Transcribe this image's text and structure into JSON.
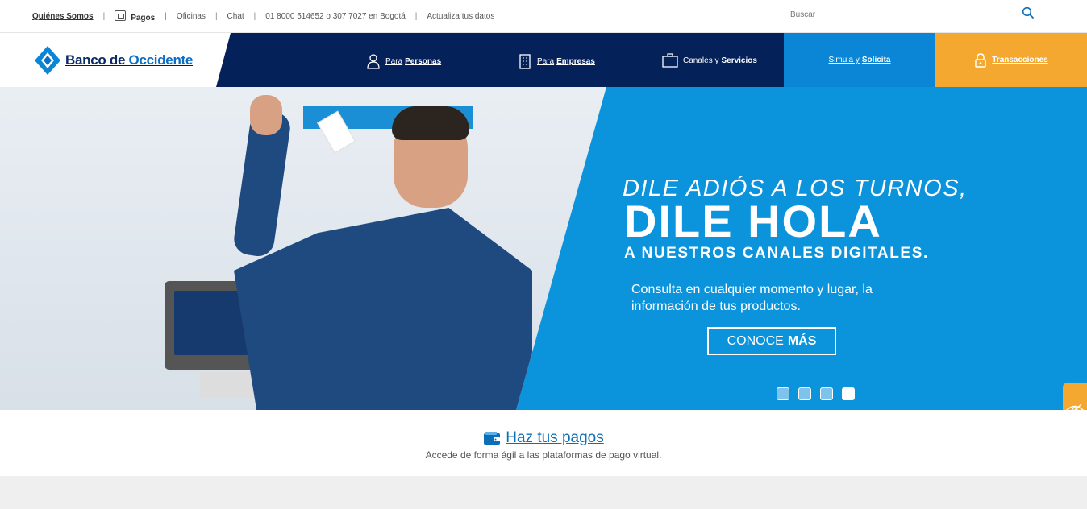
{
  "topbar": {
    "links": {
      "quienes": "Quiénes Somos",
      "pagos": "Pagos",
      "oficinas": "Oficinas",
      "chat": "Chat",
      "telefono": "01 8000 514652 o 307 7027 en Bogotá",
      "actualiza": "Actualiza tus datos"
    },
    "separator": "|",
    "search_placeholder": "Buscar"
  },
  "brand": {
    "name_part1": "Banco de ",
    "name_part2": "Occidente",
    "primary_color": "#05215a",
    "accent_color": "#0b86d6",
    "orange_color": "#f5a830"
  },
  "nav": {
    "personas": {
      "prefix": "Para",
      "label": "Personas"
    },
    "empresas": {
      "prefix": "Para",
      "label": "Empresas"
    },
    "canales": {
      "prefix": "Canales y",
      "label": "Servicios"
    },
    "simula": {
      "prefix": "Simula y",
      "label": "Solicita"
    },
    "transacciones": "Transacciones"
  },
  "hero": {
    "line1": "DILE ADIÓS A LOS TURNOS,",
    "line2": "DILE HOLA",
    "line3": "A NUESTROS CANALES DIGITALES.",
    "description": "Consulta en cualquier momento y lugar, la información de tus productos.",
    "cta_prefix": "CONOCE",
    "cta_bold": "MÁS",
    "slides_total": 4,
    "active_slide": 4
  },
  "pagos_section": {
    "title": "Haz tus pagos",
    "subtitle": "Accede de forma ágil a las plataformas de pago virtual."
  }
}
